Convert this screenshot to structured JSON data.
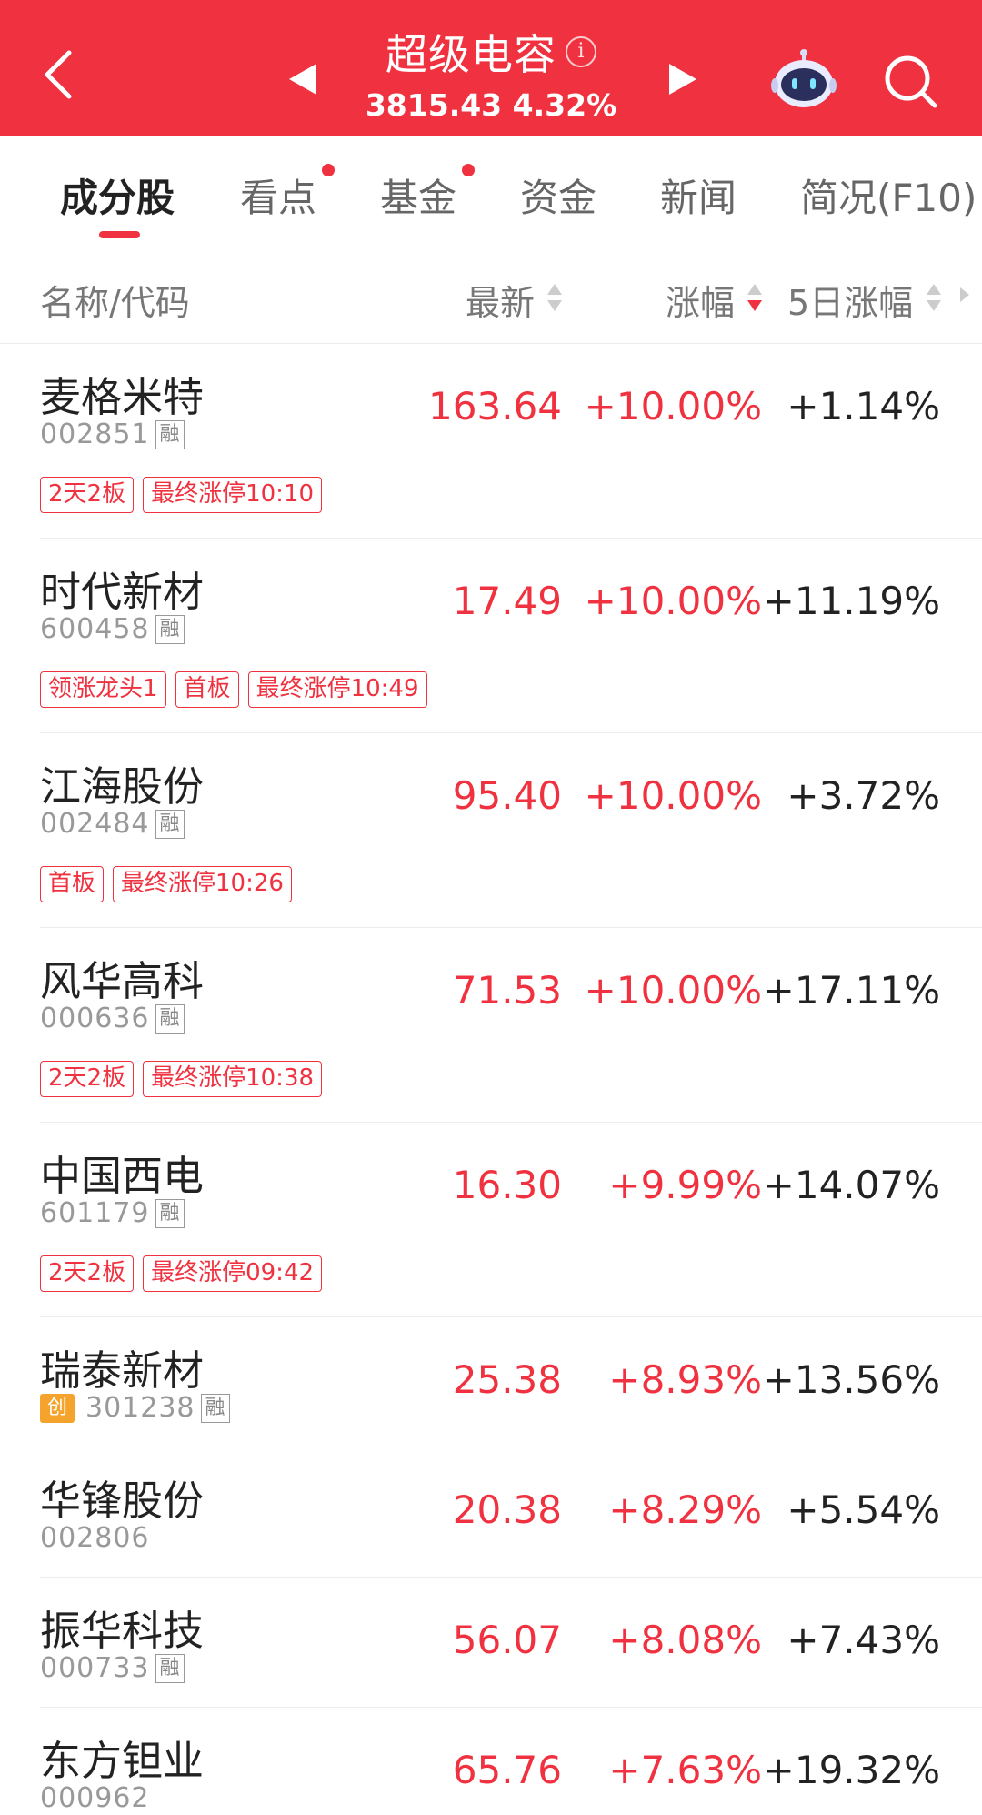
{
  "header": {
    "title": "超级电容",
    "index_value": "3815.43",
    "index_change": "4.32%"
  },
  "colors": {
    "brand_red": "#f03240",
    "up_red": "#f03240",
    "text_dark": "#222222",
    "text_gray": "#999999",
    "chuang_orange": "#f4a32c"
  },
  "icons": {
    "back": "back-chevron-icon",
    "prev": "triangle-left-icon",
    "next": "triangle-right-icon",
    "info": "info-icon",
    "robot": "robot-assistant-icon",
    "search": "search-icon"
  },
  "tabs": [
    {
      "label": "成分股",
      "active": true
    },
    {
      "label": "看点",
      "badge": true
    },
    {
      "label": "基金",
      "badge": true
    },
    {
      "label": "资金"
    },
    {
      "label": "新闻"
    },
    {
      "label": "简况(F10)"
    }
  ],
  "columns": {
    "name": "名称/代码",
    "price": "最新",
    "change": "涨幅",
    "change5": "5日涨幅"
  },
  "stocks": [
    {
      "name": "麦格米特",
      "code": "002851",
      "rong": "融",
      "price": "163.64",
      "change": "+10.00%",
      "change5": "+1.14%",
      "tags": [
        "2天2板",
        "最终涨停10:10"
      ]
    },
    {
      "name": "时代新材",
      "code": "600458",
      "rong": "融",
      "price": "17.49",
      "change": "+10.00%",
      "change5": "+11.19%",
      "tags": [
        "领涨龙头1",
        "首板",
        "最终涨停10:49"
      ]
    },
    {
      "name": "江海股份",
      "code": "002484",
      "rong": "融",
      "price": "95.40",
      "change": "+10.00%",
      "change5": "+3.72%",
      "tags": [
        "首板",
        "最终涨停10:26"
      ]
    },
    {
      "name": "风华高科",
      "code": "000636",
      "rong": "融",
      "price": "71.53",
      "change": "+10.00%",
      "change5": "+17.11%",
      "tags": [
        "2天2板",
        "最终涨停10:38"
      ]
    },
    {
      "name": "中国西电",
      "code": "601179",
      "rong": "融",
      "price": "16.30",
      "change": "+9.99%",
      "change5": "+14.07%",
      "tags": [
        "2天2板",
        "最终涨停09:42"
      ]
    },
    {
      "name": "瑞泰新材",
      "code": "301238",
      "rong": "融",
      "chuang": "创",
      "price": "25.38",
      "change": "+8.93%",
      "change5": "+13.56%",
      "tags": []
    },
    {
      "name": "华锋股份",
      "code": "002806",
      "price": "20.38",
      "change": "+8.29%",
      "change5": "+5.54%",
      "tags": []
    },
    {
      "name": "振华科技",
      "code": "000733",
      "rong": "融",
      "price": "56.07",
      "change": "+8.08%",
      "change5": "+7.43%",
      "tags": []
    },
    {
      "name": "东方钽业",
      "code": "000962",
      "price": "65.76",
      "change": "+7.63%",
      "change5": "+19.32%",
      "tags": []
    }
  ]
}
